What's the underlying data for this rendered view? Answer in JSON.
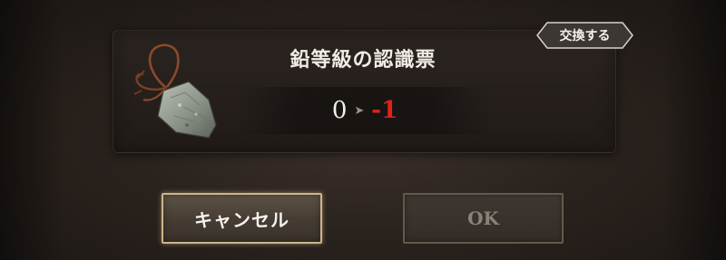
{
  "dialog": {
    "item_name": "鉛等級の認識票",
    "count_from": "0",
    "count_arrow": "➤",
    "count_to": "-1",
    "exchange_label": "交換する",
    "item_icon": "lead-dog-tag-icon"
  },
  "buttons": {
    "cancel_label": "キャンセル",
    "ok_label": "OK",
    "ok_enabled": false
  },
  "colors": {
    "background": "#2a221d",
    "panel": "#241e1a",
    "negative_count": "#e0221c",
    "button_border_active": "#cdb58a",
    "button_border_disabled": "#66584a"
  }
}
